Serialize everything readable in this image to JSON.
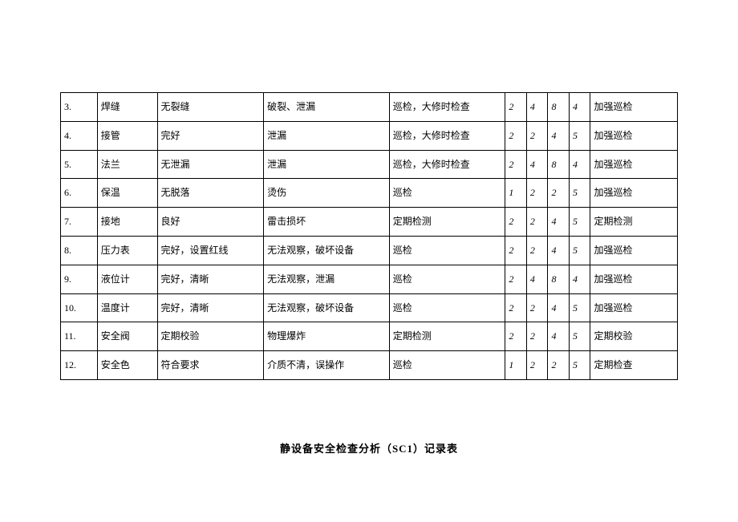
{
  "table": {
    "rows": [
      {
        "num": "3.",
        "item": "焊缝",
        "std": "无裂缝",
        "fail": "破裂、泄漏",
        "method": "巡检，大修时检查",
        "n1": "2",
        "n2": "4",
        "n3": "8",
        "n4": "4",
        "action": "加强巡检"
      },
      {
        "num": "4.",
        "item": "接管",
        "std": "完好",
        "fail": "泄漏",
        "method": "巡检，大修时检查",
        "n1": "2",
        "n2": "2",
        "n3": "4",
        "n4": "5",
        "action": "加强巡检"
      },
      {
        "num": "5.",
        "item": "法兰",
        "std": "无泄漏",
        "fail": "泄漏",
        "method": "巡检，大修时检查",
        "n1": "2",
        "n2": "4",
        "n3": "8",
        "n4": "4",
        "action": "加强巡检"
      },
      {
        "num": "6.",
        "item": "保温",
        "std": "无脱落",
        "fail": "烫伤",
        "method": "巡检",
        "n1": "1",
        "n2": "2",
        "n3": "2",
        "n4": "5",
        "action": "加强巡检"
      },
      {
        "num": "7.",
        "item": "接地",
        "std": "良好",
        "fail": "雷击损坏",
        "method": "定期检测",
        "n1": "2",
        "n2": "2",
        "n3": "4",
        "n4": "5",
        "action": "定期检测"
      },
      {
        "num": "8.",
        "item": "压力表",
        "std": "完好，设置红线",
        "fail": "无法观察，破坏设备",
        "method": "巡检",
        "n1": "2",
        "n2": "2",
        "n3": "4",
        "n4": "5",
        "action": "加强巡检"
      },
      {
        "num": "9.",
        "item": "液位计",
        "std": "完好，清晰",
        "fail": "无法观察，泄漏",
        "method": "巡检",
        "n1": "2",
        "n2": "4",
        "n3": "8",
        "n4": "4",
        "action": "加强巡检"
      },
      {
        "num": "10.",
        "item": "温度计",
        "std": "完好，清晰",
        "fail": "无法观察，破坏设备",
        "method": "巡检",
        "n1": "2",
        "n2": "2",
        "n3": "4",
        "n4": "5",
        "action": "加强巡检"
      },
      {
        "num": "11.",
        "item": "安全阀",
        "std": "定期校验",
        "fail": "物理爆炸",
        "method": "定期检测",
        "n1": "2",
        "n2": "2",
        "n3": "4",
        "n4": "5",
        "action": "定期校验"
      },
      {
        "num": "12.",
        "item": "安全色",
        "std": "符合要求",
        "fail": "介质不清，误操作",
        "method": "巡检",
        "n1": "1",
        "n2": "2",
        "n3": "2",
        "n4": "5",
        "action": "定期检查"
      }
    ]
  },
  "footer": {
    "title": "静设备安全检查分析（SC1）记录表"
  }
}
